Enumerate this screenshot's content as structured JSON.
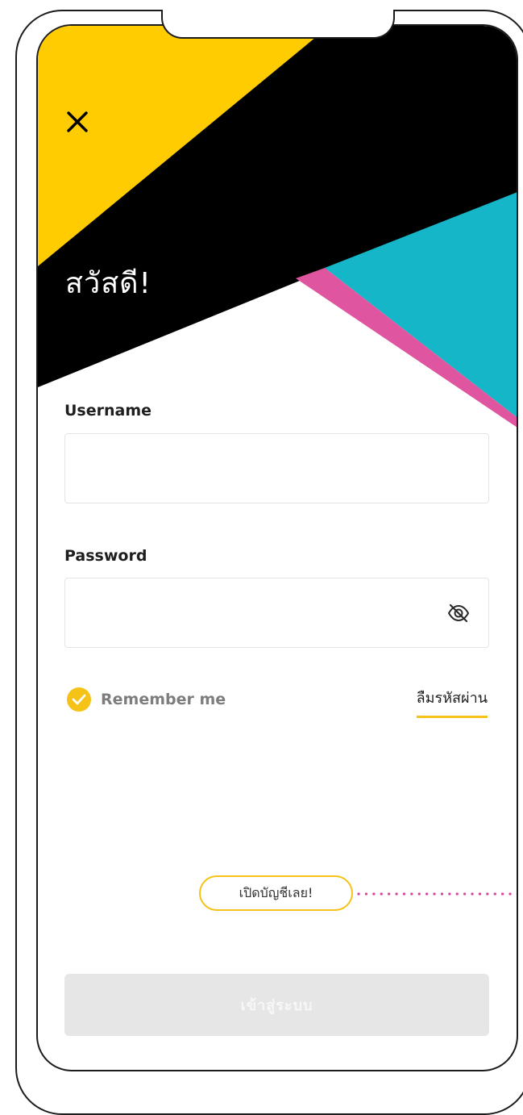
{
  "greeting": "สวัสดี!",
  "username": {
    "label": "Username",
    "value": ""
  },
  "password": {
    "label": "Password",
    "value": ""
  },
  "remember_me": {
    "label": "Remember me",
    "checked": true
  },
  "forgot_password_label": "ลืมรหัสผ่าน",
  "open_account_label": "เปิดบัญชีเลย!",
  "login_button_label": "เข้าสู่ระบบ",
  "icons": {
    "close": "close-icon",
    "eye": "eye-off-icon",
    "check": "check-icon"
  },
  "colors": {
    "yellow": "#FECC00",
    "black": "#000000",
    "cyan": "#15B6C8",
    "pink": "#E0559F",
    "accent_border": "#F5C218",
    "dotted_annotation": "#D4469A",
    "disabled_button": "#E6E6E6"
  }
}
